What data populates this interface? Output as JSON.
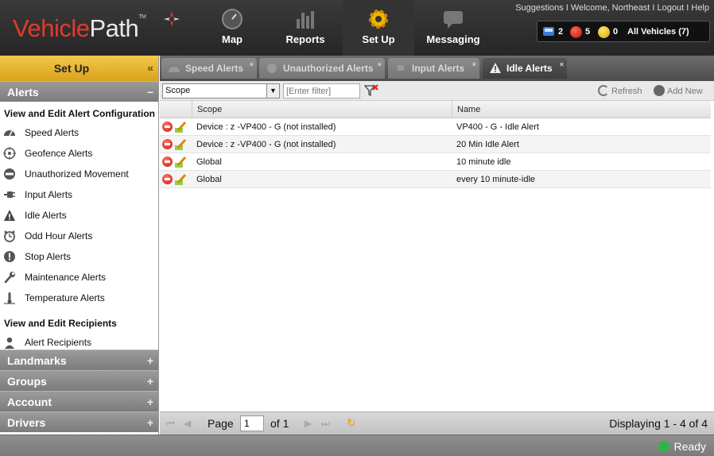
{
  "app": {
    "logo_part1": "Vehicle",
    "logo_part2": "Path",
    "logo_tm": "TM"
  },
  "nav": [
    {
      "label": "Map",
      "icon": "speedometer-icon"
    },
    {
      "label": "Reports",
      "icon": "bar-chart-icon"
    },
    {
      "label": "Set Up",
      "icon": "gear-icon",
      "active": true
    },
    {
      "label": "Messaging",
      "icon": "speech-bubble-icon"
    }
  ],
  "top_links": {
    "suggestions": "Suggestions",
    "welcome": "Welcome, Northeast",
    "logout": "Logout",
    "help": "Help"
  },
  "vehicle_status": {
    "blue_count": "2",
    "red_count": "5",
    "yellow_count": "0",
    "label": "All Vehicles (7)"
  },
  "left_panel": {
    "title": "Set Up",
    "collapse": "«",
    "alerts": {
      "header": "Alerts",
      "toggle": "−",
      "section1": "View and Edit Alert Configuration",
      "items": [
        {
          "label": "Speed Alerts",
          "icon": "speedometer-icon"
        },
        {
          "label": "Geofence Alerts",
          "icon": "geofence-icon"
        },
        {
          "label": "Unauthorized Movement",
          "icon": "no-entry-icon"
        },
        {
          "label": "Input Alerts",
          "icon": "plug-icon"
        },
        {
          "label": "Idle Alerts",
          "icon": "warning-icon"
        },
        {
          "label": "Odd Hour Alerts",
          "icon": "alarm-clock-icon"
        },
        {
          "label": "Stop Alerts",
          "icon": "stop-icon"
        },
        {
          "label": "Maintenance Alerts",
          "icon": "wrench-icon"
        },
        {
          "label": "Temperature Alerts",
          "icon": "thermometer-icon"
        }
      ],
      "section2": "View and Edit Recipients",
      "recipients": {
        "label": "Alert Recipients",
        "icon": "person-icon"
      }
    },
    "collapsed_sections": [
      {
        "label": "Landmarks",
        "toggle": "+"
      },
      {
        "label": "Groups",
        "toggle": "+"
      },
      {
        "label": "Account",
        "toggle": "+"
      },
      {
        "label": "Drivers",
        "toggle": "+"
      }
    ]
  },
  "tabs": [
    {
      "label": "Speed Alerts",
      "close": "×"
    },
    {
      "label": "Unauthorized Alerts",
      "close": "×"
    },
    {
      "label": "Input Alerts",
      "close": "×"
    },
    {
      "label": "Idle Alerts",
      "close": "×",
      "active": true
    }
  ],
  "toolbar": {
    "scope_value": "Scope",
    "filter_placeholder": "[Enter filter]",
    "refresh_label": "Refresh",
    "add_new_label": "Add New"
  },
  "grid": {
    "columns": [
      "Scope",
      "Name"
    ],
    "rows": [
      {
        "scope": "Device : z -VP400 - G (not installed)",
        "name": "VP400 - G - Idle Alert"
      },
      {
        "scope": "Device : z -VP400 - G (not installed)",
        "name": "20 Min Idle Alert"
      },
      {
        "scope": "Global",
        "name": "10 minute idle"
      },
      {
        "scope": "Global",
        "name": "every 10 minute-idle"
      }
    ]
  },
  "pager": {
    "page_label": "Page",
    "page_value": "1",
    "of_label": "of 1",
    "display_text": "Displaying 1 - 4 of 4"
  },
  "status": {
    "ready": "Ready"
  },
  "colors": {
    "accent": "#f0c040",
    "brand_red": "#e23a2a",
    "header": "#2c2c2c"
  }
}
